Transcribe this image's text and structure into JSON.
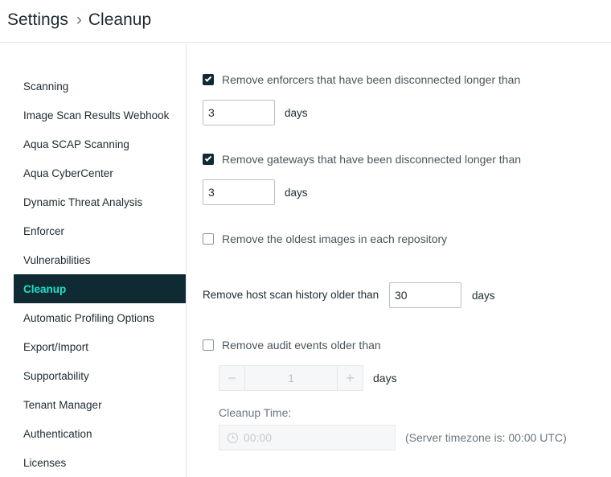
{
  "breadcrumb": {
    "root": "Settings",
    "separator": "›",
    "current": "Cleanup"
  },
  "sidebar": {
    "items": [
      {
        "label": "Scanning",
        "active": false
      },
      {
        "label": "Image Scan Results Webhook",
        "active": false
      },
      {
        "label": "Aqua SCAP Scanning",
        "active": false
      },
      {
        "label": "Aqua CyberCenter",
        "active": false
      },
      {
        "label": "Dynamic Threat Analysis",
        "active": false
      },
      {
        "label": "Enforcer",
        "active": false
      },
      {
        "label": "Vulnerabilities",
        "active": false
      },
      {
        "label": "Cleanup",
        "active": true
      },
      {
        "label": "Automatic Profiling Options",
        "active": false
      },
      {
        "label": "Export/Import",
        "active": false
      },
      {
        "label": "Supportability",
        "active": false
      },
      {
        "label": "Tenant Manager",
        "active": false
      },
      {
        "label": "Authentication",
        "active": false
      },
      {
        "label": "Licenses",
        "active": false
      }
    ]
  },
  "cleanup": {
    "enforcers": {
      "label": "Remove enforcers that have been disconnected longer than",
      "checked": true,
      "value": "3",
      "unit": "days"
    },
    "gateways": {
      "label": "Remove gateways that have been disconnected longer than",
      "checked": true,
      "value": "3",
      "unit": "days"
    },
    "oldest_images": {
      "label": "Remove the oldest images in each repository",
      "checked": false
    },
    "host_scan": {
      "label": "Remove host scan history older than",
      "value": "30",
      "unit": "days"
    },
    "audit_events": {
      "label": "Remove audit events older than",
      "checked": false,
      "stepper_value": "1",
      "minus": "−",
      "plus": "+",
      "unit": "days"
    },
    "cleanup_time": {
      "label": "Cleanup Time:",
      "placeholder": "00:00",
      "timezone_note": "(Server timezone is: 00:00 UTC)"
    }
  },
  "colors": {
    "active_bg": "#0f2a33",
    "active_text": "#1fe0c8",
    "checkbox_checked": "#0f2a33"
  }
}
